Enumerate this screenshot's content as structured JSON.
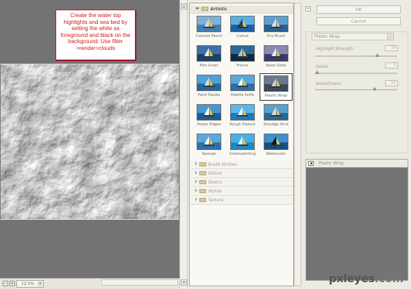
{
  "note": {
    "text": "Create the water top highlights and sea bed by setting the white as foreground and black on the background. Use filter >render>clouds"
  },
  "preview": {
    "zoom_minus": "−",
    "zoom_plus": "+",
    "zoom_value": "12.5%",
    "zoom_arrow": "▾"
  },
  "gallery": {
    "open_category": "Artistic",
    "thumbnails": [
      {
        "label": "Colored Pencil"
      },
      {
        "label": "Cutout"
      },
      {
        "label": "Dry Brush"
      },
      {
        "label": "Film Grain"
      },
      {
        "label": "Fresco"
      },
      {
        "label": "Neon Glow"
      },
      {
        "label": "Paint Daubs"
      },
      {
        "label": "Palette Knife"
      },
      {
        "label": "Plastic Wrap"
      },
      {
        "label": "Poster Edges"
      },
      {
        "label": "Rough Pastels"
      },
      {
        "label": "Smudge Stick"
      },
      {
        "label": "Sponge"
      },
      {
        "label": "Underpainting"
      },
      {
        "label": "Watercolor"
      }
    ],
    "selected_index": 8,
    "categories": [
      {
        "label": "Brush Strokes"
      },
      {
        "label": "Distort"
      },
      {
        "label": "Sketch"
      },
      {
        "label": "Stylize"
      },
      {
        "label": "Texture"
      }
    ]
  },
  "settings": {
    "ok_label": "OK",
    "cancel_label": "Cancel",
    "collapse_icon": "«",
    "filter_select": "Plastic Wrap",
    "filter_select_arrow": "⌄",
    "params": [
      {
        "label": "Highlight Strength",
        "value": "15",
        "fraction": 0.75
      },
      {
        "label": "Detail",
        "value": "1",
        "fraction": 0.0
      },
      {
        "label": "Smoothness",
        "value": "11",
        "fraction": 0.72
      }
    ]
  },
  "layers": {
    "items": [
      {
        "label": "Plastic Wrap"
      }
    ]
  },
  "watermark": {
    "main": "pxleyes",
    "suffix": ".com"
  },
  "colors": {
    "note_border": "#c8102e",
    "note_text": "#d01a1a",
    "panel_bg": "#ecebe3",
    "preview_bg": "#737373"
  }
}
